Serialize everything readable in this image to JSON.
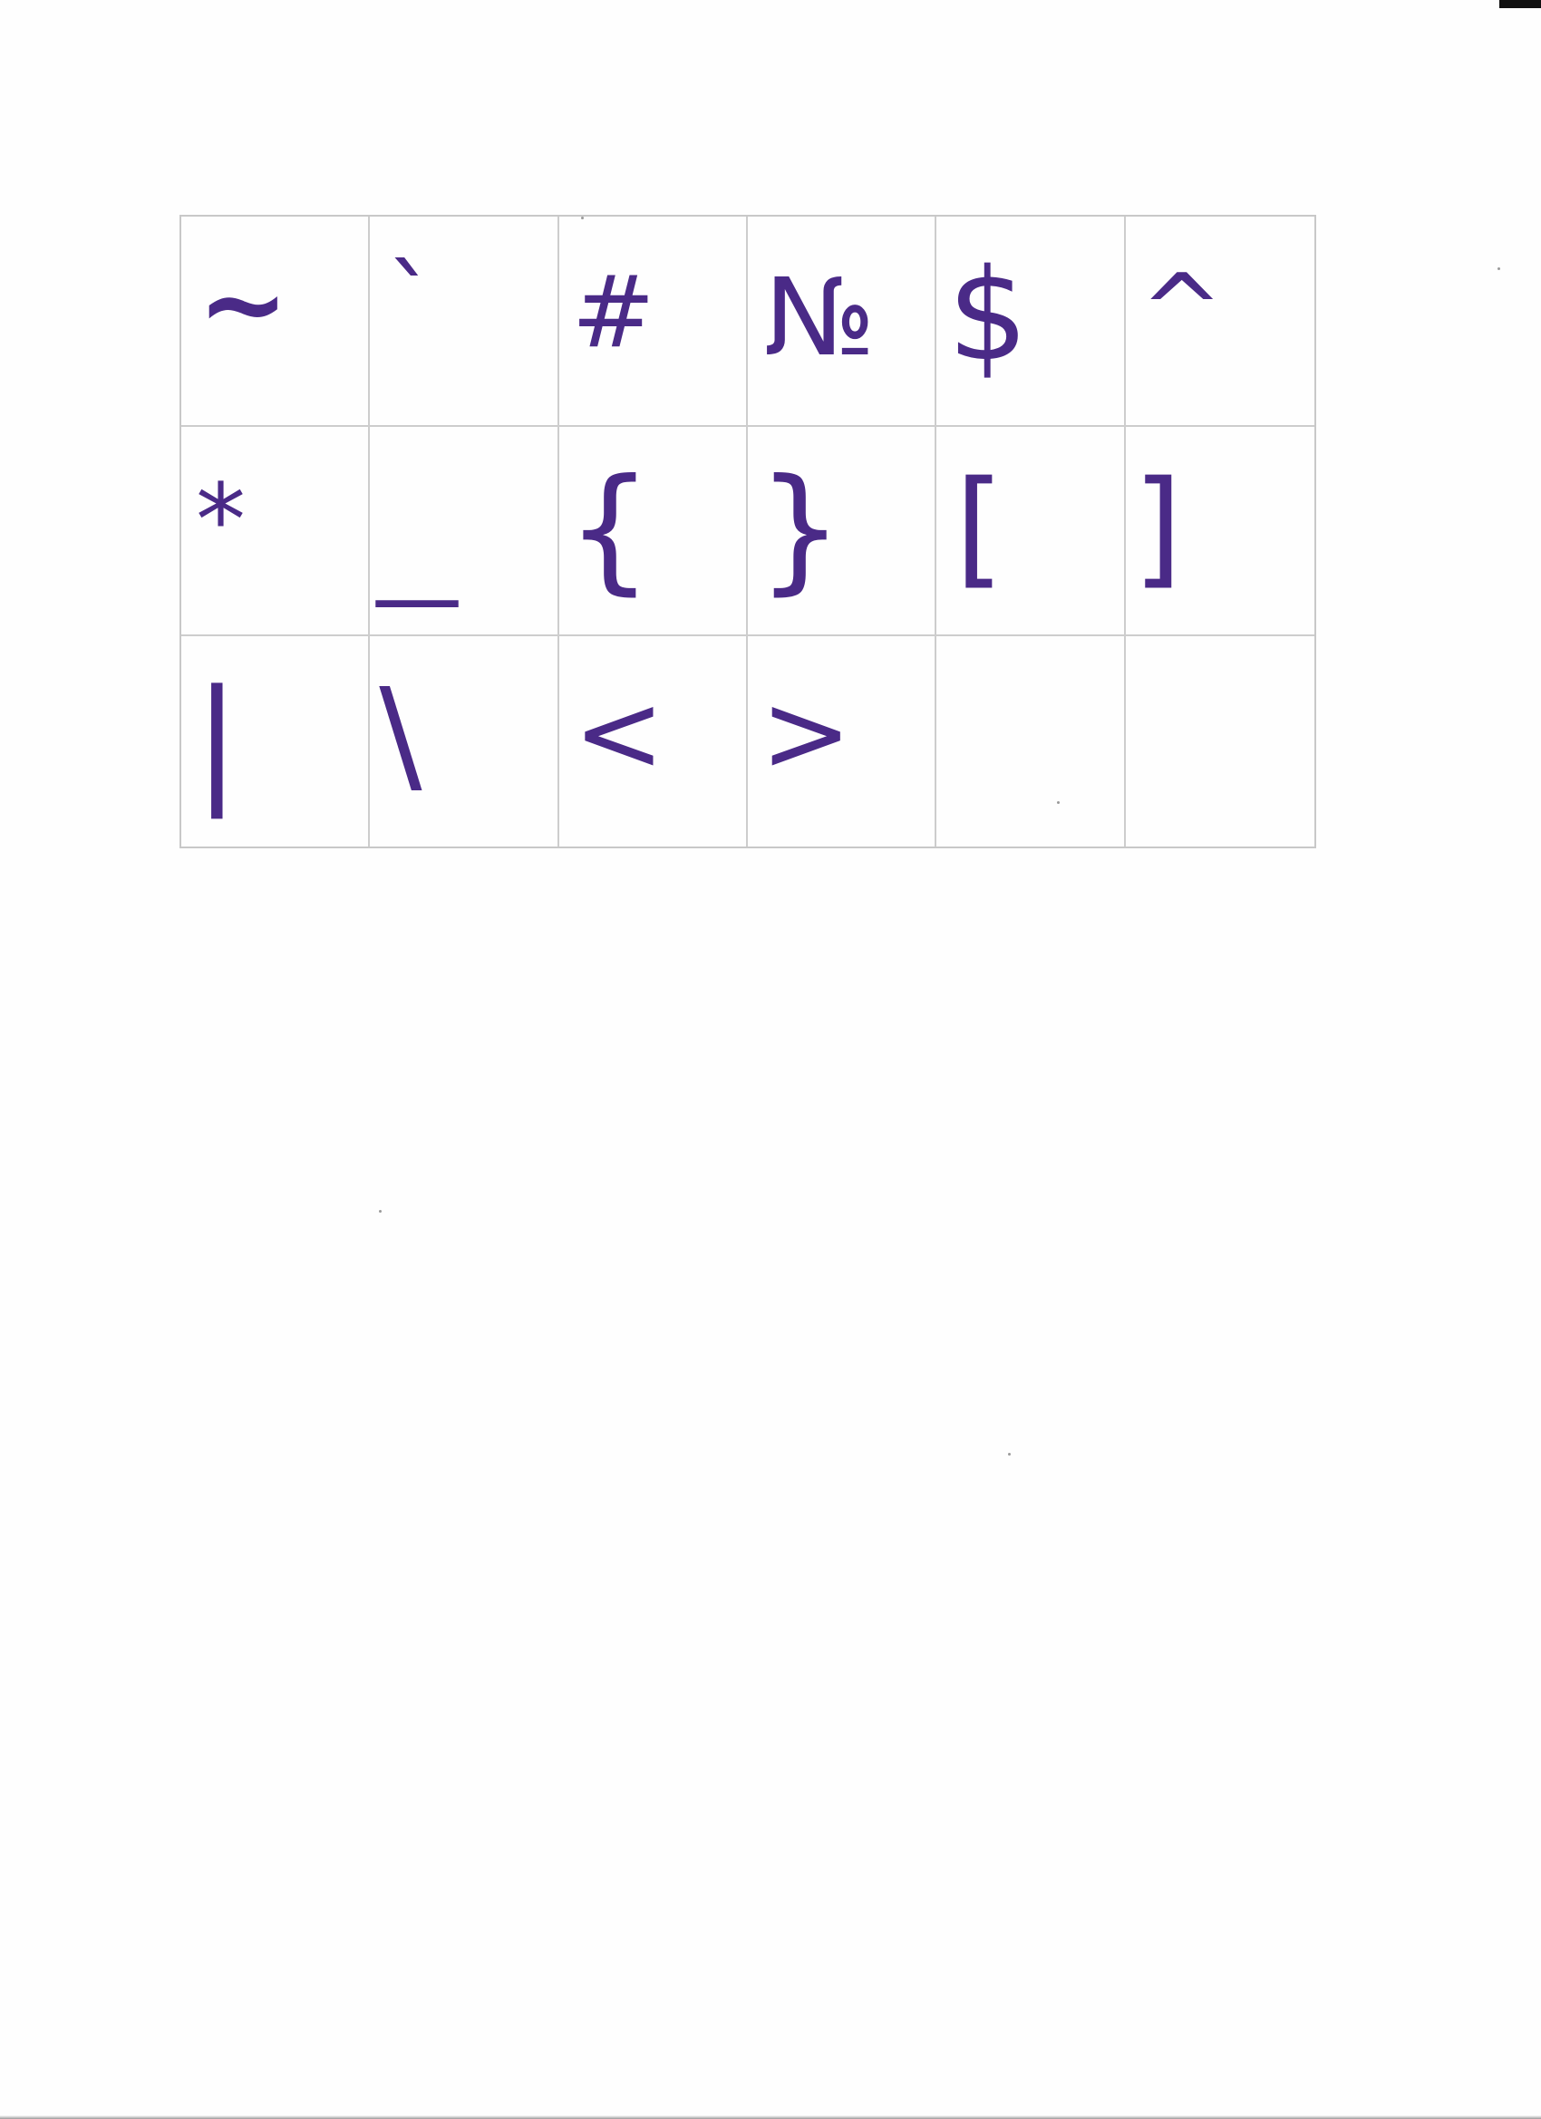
{
  "glyph_table": {
    "rows": [
      [
        {
          "name": "tilde",
          "symbol": "~"
        },
        {
          "name": "backtick",
          "symbol": "`"
        },
        {
          "name": "hash",
          "symbol": "#"
        },
        {
          "name": "numero",
          "symbol": "№"
        },
        {
          "name": "dollar",
          "symbol": "$"
        },
        {
          "name": "caret",
          "symbol": "^"
        }
      ],
      [
        {
          "name": "asterisk",
          "symbol": "*"
        },
        {
          "name": "underscore",
          "symbol": "_"
        },
        {
          "name": "left-brace",
          "symbol": "{"
        },
        {
          "name": "right-brace",
          "symbol": "}"
        },
        {
          "name": "left-bracket",
          "symbol": "["
        },
        {
          "name": "right-bracket",
          "symbol": "]"
        }
      ],
      [
        {
          "name": "pipe",
          "symbol": "|"
        },
        {
          "name": "backslash",
          "symbol": "\\"
        },
        {
          "name": "less-than",
          "symbol": "<"
        },
        {
          "name": "greater-than",
          "symbol": ">"
        },
        {
          "name": "empty",
          "symbol": ""
        },
        {
          "name": "empty",
          "symbol": ""
        }
      ]
    ]
  },
  "ink_color": "#4a2a87"
}
